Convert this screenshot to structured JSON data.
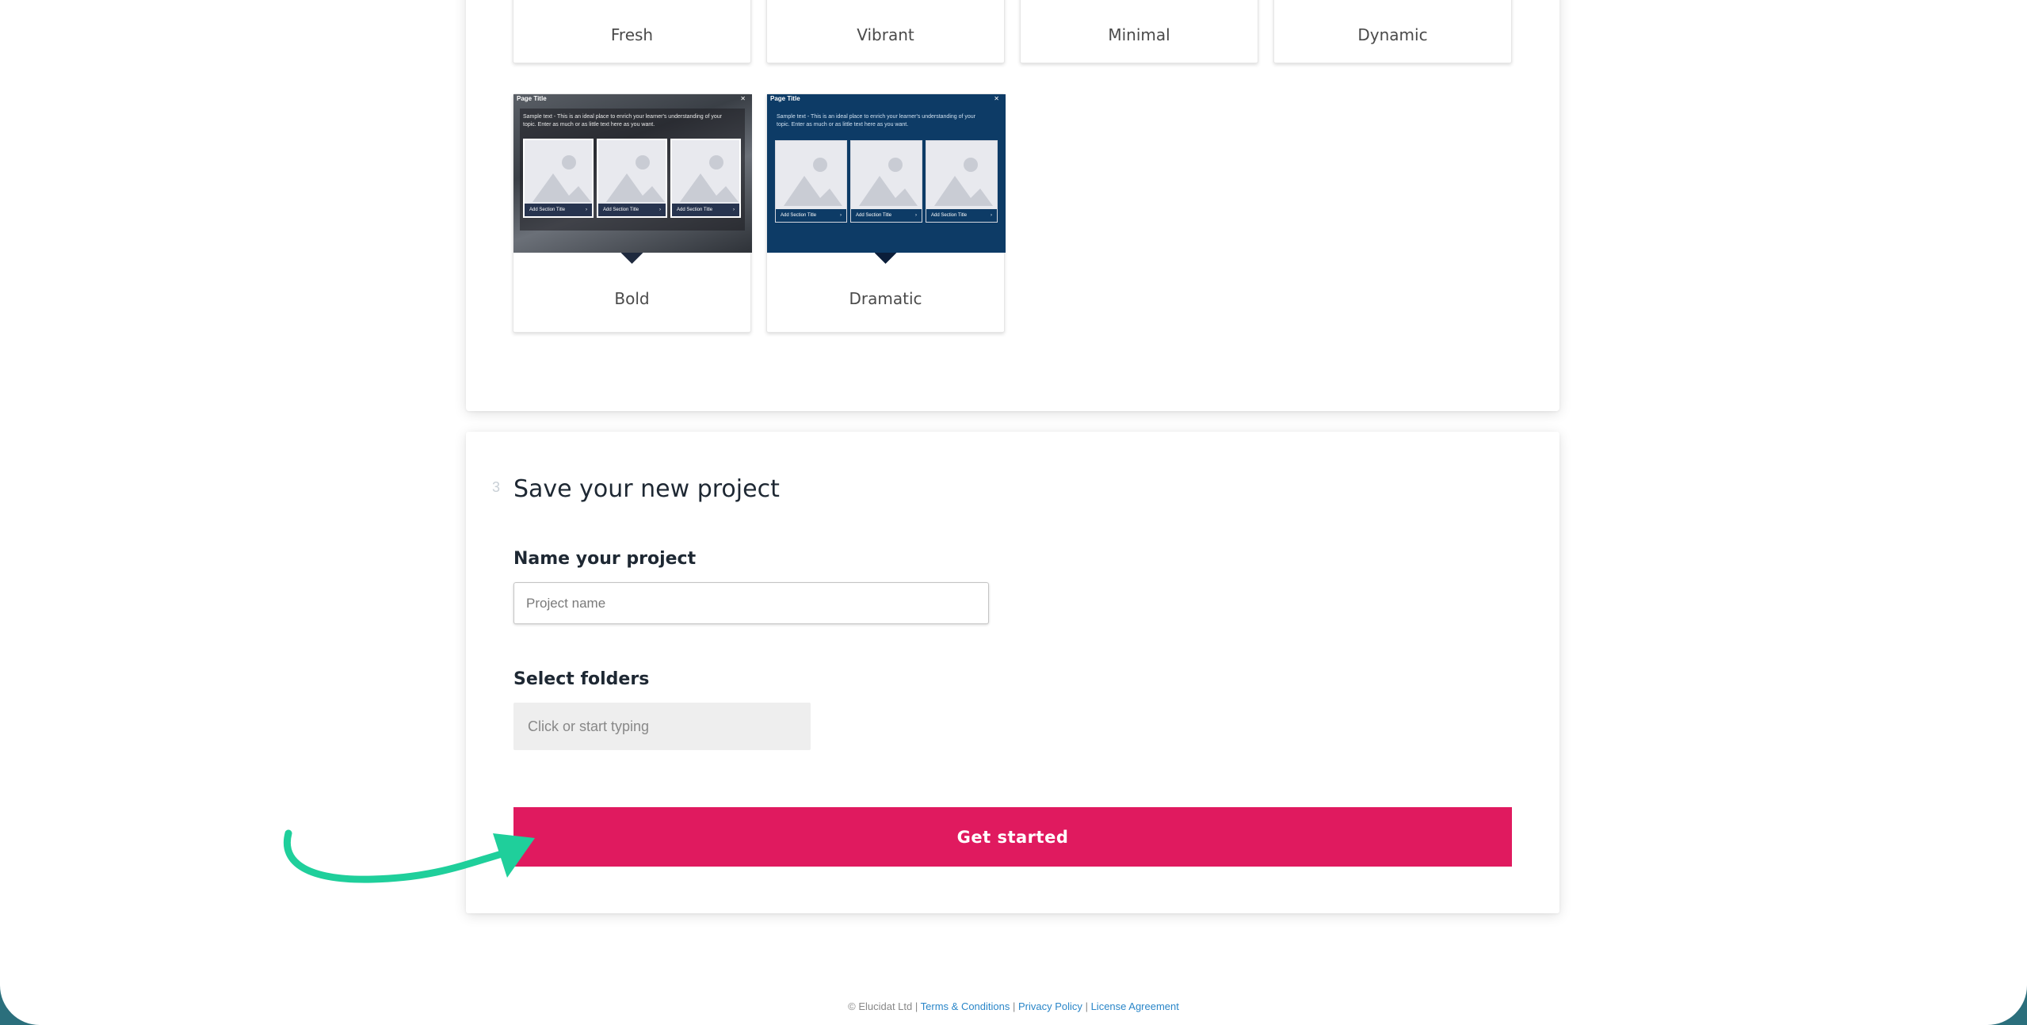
{
  "themes": {
    "row1": [
      {
        "name": "Fresh",
        "pin_color": "#d9d0c8"
      },
      {
        "name": "Vibrant",
        "pin_color": "#1a6b8a"
      },
      {
        "name": "Minimal",
        "pin_color": "#e3e3e3"
      },
      {
        "name": "Dynamic",
        "pin_color": "#4a4460"
      }
    ],
    "bold": {
      "name": "Bold",
      "preview_title": "Page Title",
      "preview_close": "✕",
      "preview_text": "Sample text - This is an ideal place to enrich your learner's understanding of your topic. Enter as much or as little text here as you want.",
      "section_caption": "Add Section Title",
      "section_arrow": "›"
    },
    "dramatic": {
      "name": "Dramatic",
      "preview_title": "Page Title",
      "preview_close": "✕",
      "preview_text": "Sample text - This is an ideal place to enrich your learner's understanding of your topic. Enter as much or as little text here as you want.",
      "section_caption": "Add Section Title",
      "section_arrow": "›"
    }
  },
  "save": {
    "step_number": "3",
    "title": "Save your new project",
    "name_label": "Name your project",
    "name_placeholder": "Project name",
    "folders_label": "Select folders",
    "folders_placeholder": "Click or start typing",
    "submit_label": "Get started"
  },
  "footer": {
    "copyright": "© Elucidat Ltd",
    "separator": "|",
    "terms": "Terms & Conditions",
    "privacy": "Privacy Policy",
    "license": "License Agreement"
  },
  "colors": {
    "accent": "#e01a5f",
    "annotation_arrow": "#1fcf9b",
    "link": "#2a86c8",
    "background": "#2b6f7c"
  },
  "icons": [
    "image-placeholder-icon",
    "chevron-right-icon",
    "close-icon",
    "annotation-arrow-icon"
  ]
}
